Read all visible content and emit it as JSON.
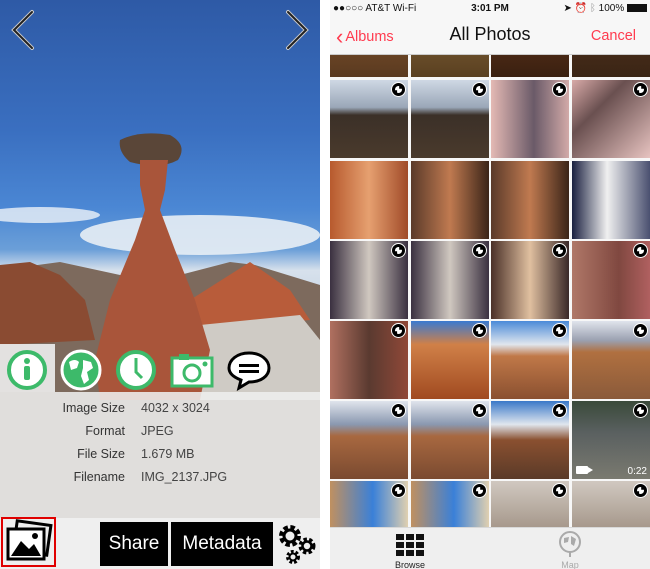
{
  "left_app": {
    "nav": {
      "prev_label": "previous-photo",
      "next_label": "next-photo"
    },
    "tabs": [
      {
        "name": "info",
        "icon": "info-icon",
        "active": true
      },
      {
        "name": "location",
        "icon": "globe-icon",
        "active": false
      },
      {
        "name": "date",
        "icon": "clock-icon",
        "active": false
      },
      {
        "name": "camera",
        "icon": "camera-icon",
        "active": false
      },
      {
        "name": "comments",
        "icon": "speech-bubble-icon",
        "active": false
      }
    ],
    "info": [
      {
        "key": "Image Size",
        "value": "4032 x 3024"
      },
      {
        "key": "Format",
        "value": "JPEG"
      },
      {
        "key": "File Size",
        "value": "1.679 MB"
      },
      {
        "key": "Filename",
        "value": "IMG_2137.JPG"
      }
    ],
    "bottom": {
      "share_label": "Share",
      "metadata_label": "Metadata"
    },
    "colors": {
      "accent_green": "#3dba6a",
      "highlight_red": "#e00000"
    }
  },
  "right_app": {
    "status": {
      "carrier": "●●○○○ AT&T Wi-Fi",
      "time": "3:01 PM",
      "battery": "100%"
    },
    "nav": {
      "back_label": "Albums",
      "title": "All Photos",
      "cancel_label": "Cancel"
    },
    "tab_bar": [
      {
        "label": "Browse",
        "active": true
      },
      {
        "label": "Map",
        "active": false
      }
    ],
    "video_duration": "0:22",
    "colors": {
      "accent": "#ff3b4f"
    }
  }
}
